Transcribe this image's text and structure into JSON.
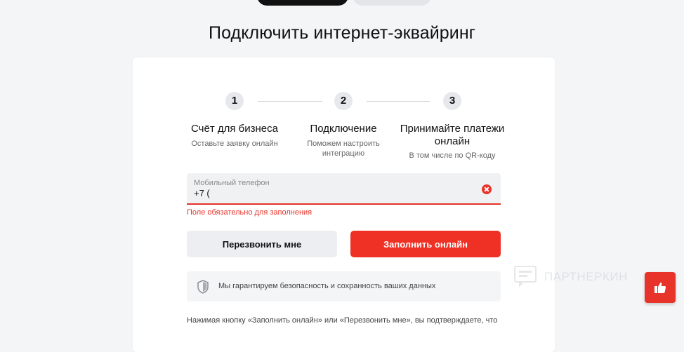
{
  "page": {
    "title": "Подключить интернет-эквайринг"
  },
  "steps": [
    {
      "number": "1",
      "title": "Счёт для бизнеса",
      "subtitle": "Оставьте заявку онлайн"
    },
    {
      "number": "2",
      "title": "Подключение",
      "subtitle": "Поможем настроить интеграцию"
    },
    {
      "number": "3",
      "title": "Принимайте платежи онлайн",
      "subtitle": "В том числе по QR-коду"
    }
  ],
  "form": {
    "phone_label": "Мобильный телефон",
    "phone_value": "+7 (",
    "error": "Поле обязательно для заполнения",
    "callback_label": "Перезвонить мне",
    "fill_online_label": "Заполнить онлайн",
    "security_note": "Мы гарантируем безопасность и сохранность ваших данных",
    "disclaimer": "Нажимая кнопку «Заполнить онлайн» или «Перезвонить мне», вы подтверждаете, что"
  },
  "watermark": {
    "text": "ПАРТНЕРКИН"
  },
  "colors": {
    "accent": "#ee3124",
    "error": "#e7332a"
  },
  "icons": {
    "clear": "close-circle-icon",
    "security": "shield-icon",
    "like": "thumbs-up-icon"
  }
}
